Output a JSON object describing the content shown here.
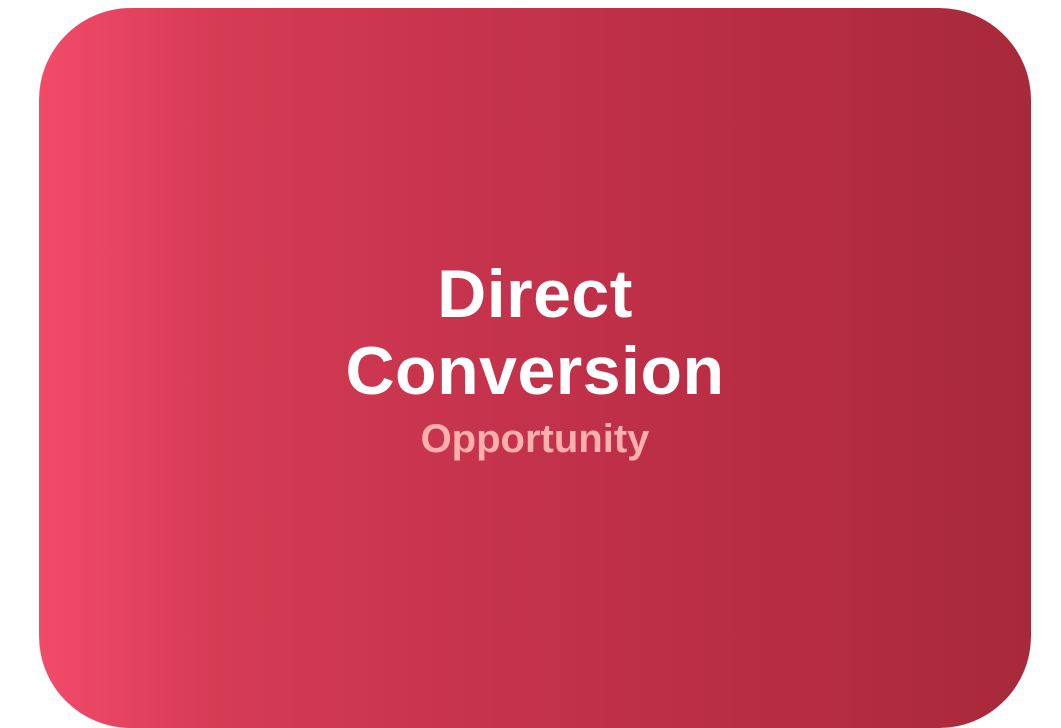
{
  "card": {
    "title_line1": "Direct",
    "title_line2": "Conversion",
    "subtitle": "Opportunity",
    "colors": {
      "gradient_start": "#f24b6a",
      "gradient_end": "#a72a3a",
      "title_text": "#ffffff",
      "subtitle_text": "#ffb0ac"
    }
  }
}
